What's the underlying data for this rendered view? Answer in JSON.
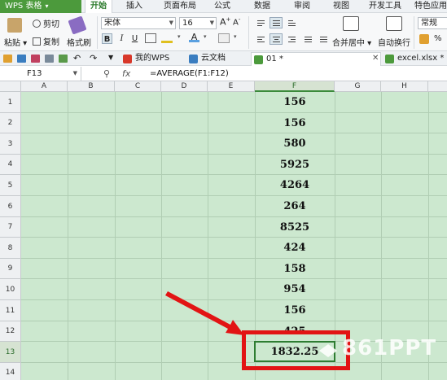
{
  "menu": {
    "app_button": "WPS 表格",
    "tabs": [
      "开始",
      "插入",
      "页面布局",
      "公式",
      "数据",
      "审阅",
      "视图",
      "开发工具",
      "特色应用"
    ]
  },
  "ribbon": {
    "paste": "粘贴",
    "cut": "剪切",
    "copy": "复制",
    "format_painter": "格式刷",
    "font_name": "宋体",
    "font_size": "16",
    "bold": "B",
    "italic": "I",
    "underline": "U",
    "font_color": "A",
    "merge_center": "合并居中",
    "wrap_text": "自动换行",
    "number_format": "常规"
  },
  "doc_tabs": [
    {
      "label": "我的WPS"
    },
    {
      "label": "云文档"
    },
    {
      "label": "01 *"
    },
    {
      "label": "excel.xlsx *"
    }
  ],
  "formula_bar": {
    "name_box": "F13",
    "fx": "fx",
    "formula": "=AVERAGE(F1:F12)"
  },
  "grid": {
    "columns": [
      "A",
      "B",
      "C",
      "D",
      "E",
      "F",
      "G",
      "H"
    ],
    "rows": [
      "1",
      "2",
      "3",
      "4",
      "5",
      "6",
      "7",
      "8",
      "9",
      "10",
      "11",
      "12",
      "13",
      "14"
    ],
    "column_f_values": [
      "156",
      "156",
      "580",
      "5925",
      "4264",
      "264",
      "8525",
      "424",
      "158",
      "954",
      "156",
      "425",
      "1832.25"
    ],
    "active_cell": "F13"
  },
  "watermark": "861PPT",
  "colors": {
    "accent_green": "#4c9a3c",
    "grid_fill": "#cce8cf",
    "highlight_red": "#e21414",
    "arrow_red": "#e21414"
  }
}
